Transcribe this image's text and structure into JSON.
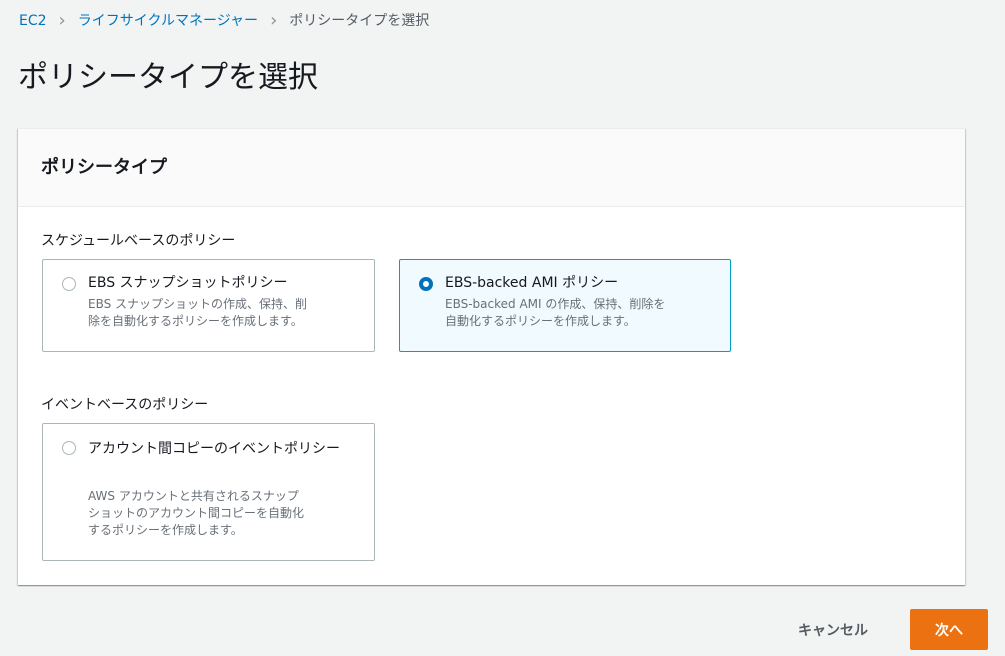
{
  "breadcrumb": {
    "items": [
      "EC2",
      "ライフサイクルマネージャー",
      "ポリシータイプを選択"
    ],
    "separator": "›"
  },
  "page_title": "ポリシータイプを選択",
  "panel": {
    "title": "ポリシータイプ",
    "groups": [
      {
        "label": "スケジュールベースのポリシー",
        "options": [
          {
            "title": "EBS スナップショットポリシー",
            "description": [
              "EBS スナップショットの作成、保持、削",
              "除を自動化するポリシーを作成します。"
            ],
            "selected": false
          },
          {
            "title": "EBS-backed AMI ポリシー",
            "description": [
              "EBS-backed AMI の作成、保持、削除を",
              "自動化するポリシーを作成します。"
            ],
            "selected": true
          }
        ]
      },
      {
        "label": "イベントベースのポリシー",
        "options": [
          {
            "title": "アカウント間コピーのイベントポリシー",
            "description": [
              "AWS アカウントと共有されるスナップ",
              "ショットのアカウント間コピーを自動化",
              "するポリシーを作成します。"
            ],
            "selected": false
          }
        ]
      }
    ]
  },
  "footer": {
    "cancel_label": "キャンセル",
    "next_label": "次へ"
  },
  "colors": {
    "link": "#0073bb",
    "selected_border": "#00a1c9",
    "selected_background": "#f1faff",
    "primary_button": "#ec7211"
  }
}
